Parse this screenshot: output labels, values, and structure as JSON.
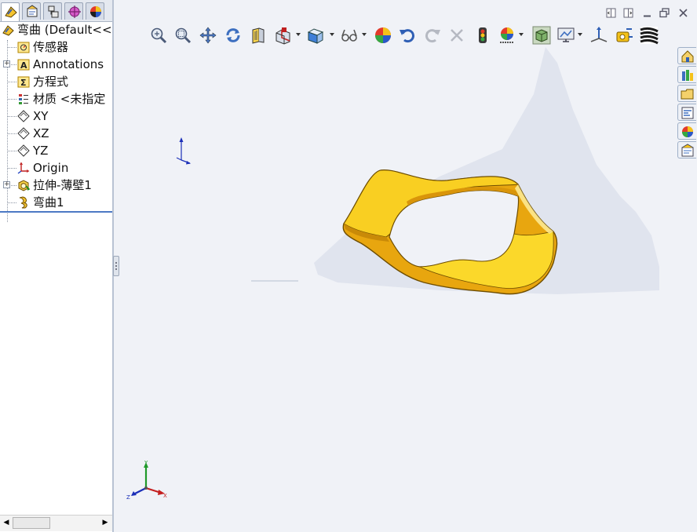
{
  "feature_tree": {
    "root_label": "弯曲 (Default<<",
    "items": [
      {
        "label": "传感器",
        "icon": "sensor-folder-icon",
        "expandable": false
      },
      {
        "label": "Annotations",
        "icon": "annotations-icon",
        "expandable": true
      },
      {
        "label": "方程式",
        "icon": "equations-icon",
        "expandable": false
      },
      {
        "label": "材质 <未指定",
        "icon": "material-icon",
        "expandable": false
      },
      {
        "label": "XY",
        "icon": "plane-icon",
        "expandable": false
      },
      {
        "label": "XZ",
        "icon": "plane-icon",
        "expandable": false
      },
      {
        "label": "YZ",
        "icon": "plane-icon",
        "expandable": false
      },
      {
        "label": "Origin",
        "icon": "origin-icon",
        "expandable": false
      },
      {
        "label": "拉伸-薄壁1",
        "icon": "extrude-thin-icon",
        "expandable": true
      },
      {
        "label": "弯曲1",
        "icon": "flex-feature-icon",
        "expandable": false
      }
    ]
  },
  "panel_tabs": [
    "feature-manager-tab-icon",
    "property-manager-tab-icon",
    "configuration-manager-tab-icon",
    "dimxpert-tab-icon",
    "display-manager-tab-icon"
  ],
  "toolbar": [
    "zoom-to-fit-icon",
    "zoom-to-area-icon",
    "pan-icon",
    "rotate-icon",
    "previous-view-icon",
    "section-view-icon",
    "view-orientation-icon",
    "hide-show-items-icon",
    "edit-appearance-icon",
    "undo-icon",
    "redo-icon",
    "cancel-icon",
    "rebuild-icon",
    "apply-scene-icon",
    "display-style-icon",
    "view-settings-icon",
    "axis-icon",
    "measure-icon",
    "zebra-stripes-icon"
  ],
  "triad": {
    "x": "X",
    "y": "Y",
    "z": "Z"
  },
  "colors": {
    "part": "#f7c815",
    "part_edge": "#6e4d00",
    "viewport_bg": "#f0f2f7",
    "tree_divider": "#4c79c4"
  }
}
